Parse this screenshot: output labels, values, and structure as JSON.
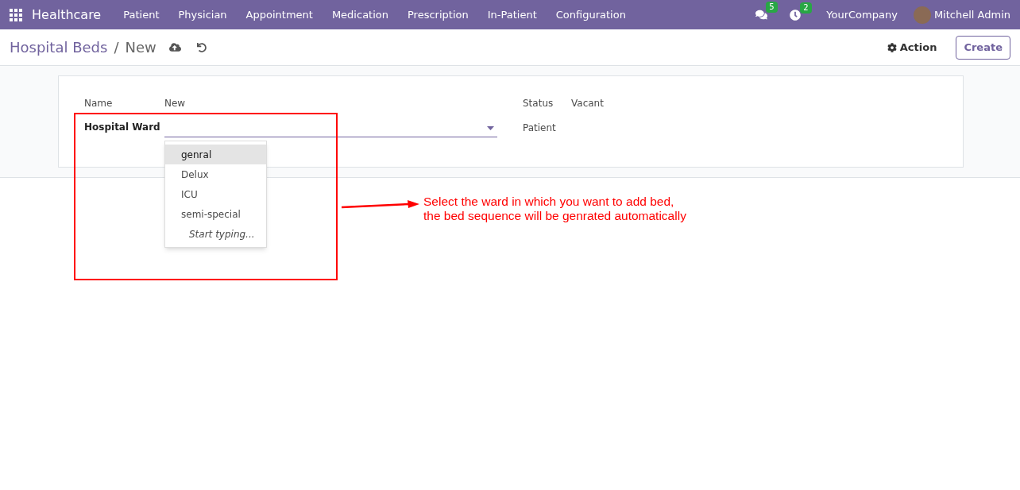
{
  "navbar": {
    "app_name": "Healthcare",
    "menu": [
      "Patient",
      "Physician",
      "Appointment",
      "Medication",
      "Prescription",
      "In-Patient",
      "Configuration"
    ],
    "messages_count": "5",
    "activities_count": "2",
    "company": "YourCompany",
    "user": "Mitchell Admin"
  },
  "breadcrumb": {
    "parent": "Hospital Beds",
    "separator": "/",
    "current": "New"
  },
  "actions": {
    "action": "Action",
    "create": "Create"
  },
  "form": {
    "name_label": "Name",
    "name_value": "New",
    "ward_label": "Hospital Ward",
    "status_label": "Status",
    "status_value": "Vacant",
    "patient_label": "Patient"
  },
  "dropdown": [
    {
      "label": "genral",
      "selected": true,
      "kind": "option"
    },
    {
      "label": "Delux",
      "selected": false,
      "kind": "option"
    },
    {
      "label": "ICU",
      "selected": false,
      "kind": "option"
    },
    {
      "label": "semi-special",
      "selected": false,
      "kind": "option"
    },
    {
      "label": "Start typing...",
      "kind": "hint"
    }
  ],
  "annotation": {
    "lines": [
      "Select the ward in which you want to add bed,",
      "the bed sequence will be genrated automatically"
    ]
  }
}
